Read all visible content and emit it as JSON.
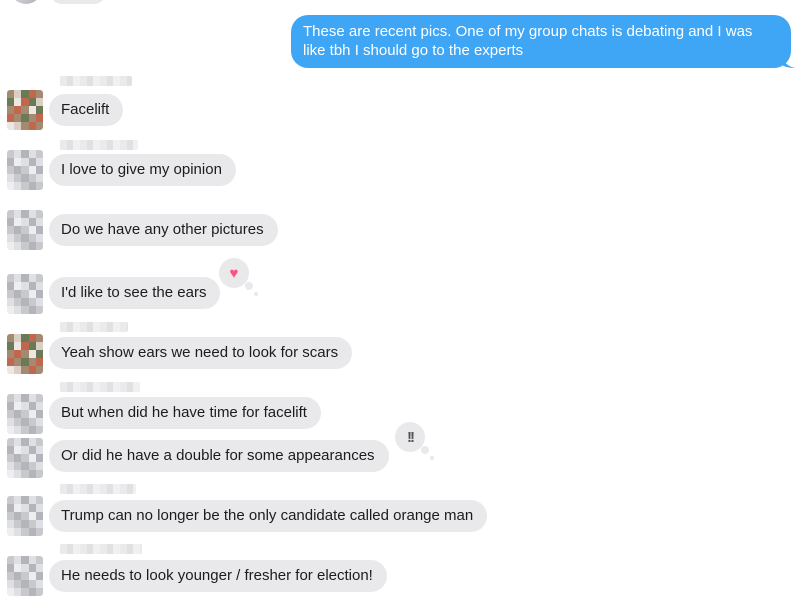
{
  "outgoing": {
    "text": "These are recent pics. One of my group chats is debating and I was like tbh I should go to the experts"
  },
  "messages": [
    {
      "text": "Facelift"
    },
    {
      "text": "I love to give my opinion"
    },
    {
      "text": "Do we have any other pictures"
    },
    {
      "text": "I'd like to see the ears"
    },
    {
      "text": "Yeah show ears we need to look for scars"
    },
    {
      "text": "But when did he have time for facelift"
    },
    {
      "text": "Or did he have a double for some appearances"
    },
    {
      "text": "Trump can no longer be the only candidate called orange man"
    },
    {
      "text": "He needs to look younger / fresher for election!"
    }
  ],
  "reactions": {
    "ears": {
      "icon": "heart-icon",
      "glyph": "♥",
      "color": "#ff4f7e"
    },
    "double": {
      "icon": "double-exclamation-icon",
      "glyph": "!!",
      "color": "#555559"
    }
  },
  "colors": {
    "outgoing_bubble": "#3fa5f5",
    "incoming_bubble": "#e9e9eb"
  }
}
